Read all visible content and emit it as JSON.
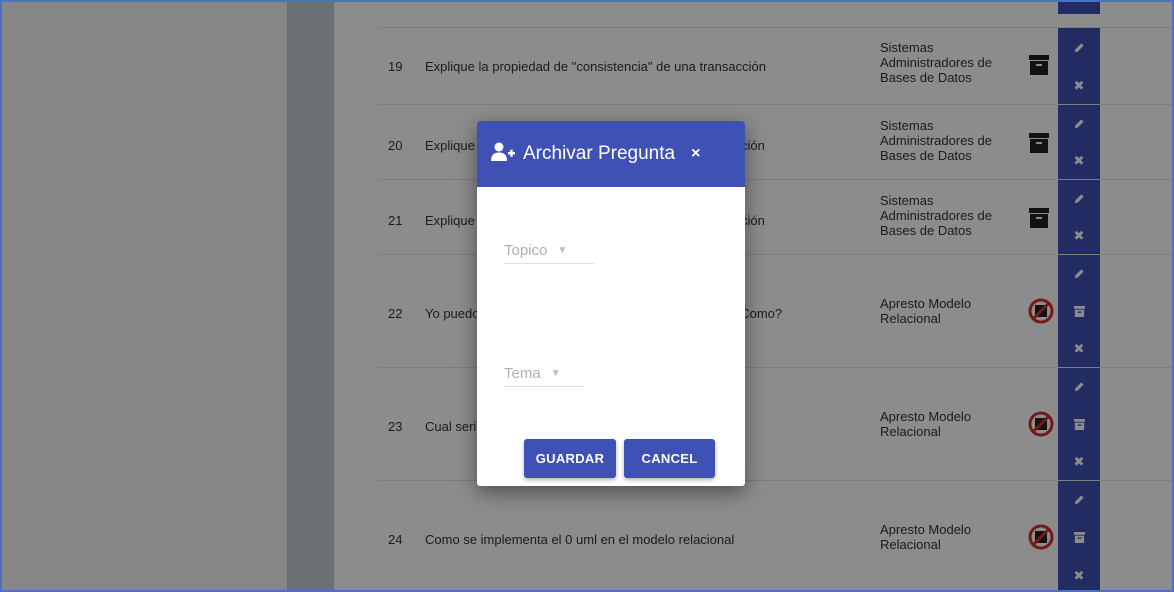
{
  "rows": [
    {
      "num": "19",
      "question": "Explique la propiedad de \"consistencia\" de una transacción",
      "topic": "Sistemas Administradores de Bases de Datos",
      "status": "archive-icon"
    },
    {
      "num": "20",
      "question": "Explique",
      "question_tail": "ción",
      "topic": "Sistemas Administradores de Bases de Datos",
      "status": "archive-icon"
    },
    {
      "num": "21",
      "question": "Explique",
      "question_tail": "ción",
      "topic": "Sistemas Administradores de Bases de Datos",
      "status": "archive-icon"
    },
    {
      "num": "22",
      "question": "Yo puedo",
      "question_tail": ". Como?",
      "topic": "Apresto Modelo Relacional",
      "status": "block-icon"
    },
    {
      "num": "23",
      "question": "Cual seri",
      "topic": "Apresto Modelo Relacional",
      "status": "block-icon"
    },
    {
      "num": "24",
      "question": "Como se implementa el 0 uml en el modelo relacional",
      "topic": "Apresto Modelo Relacional",
      "status": "block-icon"
    }
  ],
  "modal": {
    "title": "Archivar Pregunta",
    "close_label": "×",
    "topico_label": "Topico",
    "tema_label": "Tema",
    "save_label": "GUARDAR",
    "cancel_label": "CANCEL"
  },
  "colors": {
    "primary": "#3f51b5",
    "block_red": "#d32f2f"
  }
}
